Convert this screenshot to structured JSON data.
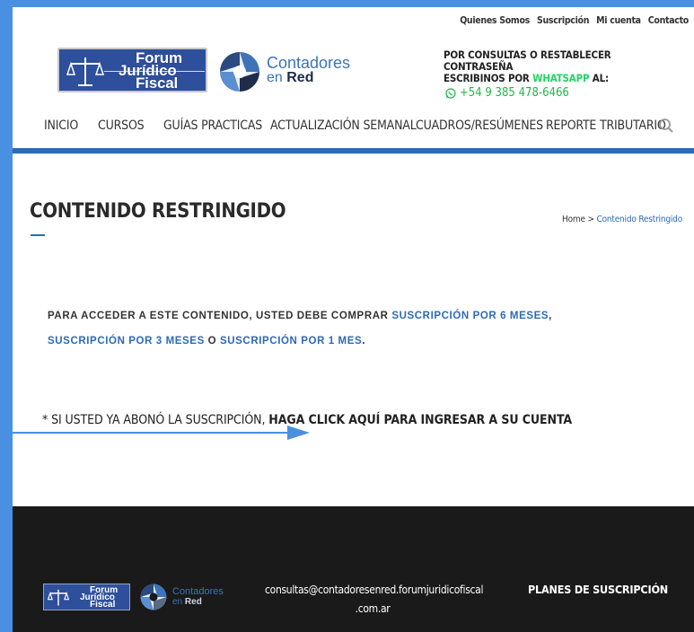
{
  "topbar": {
    "links": [
      "Quienes Somos",
      "Suscripción",
      "Mi cuenta",
      "Contacto"
    ]
  },
  "header": {
    "logo_forum": {
      "line1": "Forum",
      "line2": "Jurídico",
      "line3": "Fiscal"
    },
    "logo_cer": {
      "line1": "Contadores",
      "line2_prefix": "en ",
      "line2_bold": "Red"
    },
    "contact_line1": "POR CONSULTAS O RESTABLECER CONTRASEÑA",
    "contact_line2_prefix": "ESCRIBINOS POR ",
    "contact_line2_highlight": "WHATSAPP",
    "contact_line2_suffix": " AL:",
    "phone": "+54 9 385 478-6466"
  },
  "nav": {
    "items": [
      "INICIO",
      "CURSOS",
      "GUÍAS PRACTICAS",
      "ACTUALIZACIÓN SEMANAL",
      "CUADROS/RESÚMENES",
      "REPORTE TRIBUTARIO"
    ]
  },
  "page": {
    "title": "CONTENIDO RESTRINGIDO",
    "breadcrumb_home": "Home",
    "breadcrumb_sep": " > ",
    "breadcrumb_current": "Contenido Restringido"
  },
  "content": {
    "restrict_prefix": "PARA ACCEDER A ESTE CONTENIDO, USTED DEBE COMPRAR ",
    "link1": "SUSCRIPCIÓN POR 6 MESES",
    "sep1": ",",
    "link2": "SUSCRIPCIÓN POR 3 MESES",
    "sep2": " O ",
    "link3": "SUSCRIPCIÓN POR 1 MES",
    "sep3": ".",
    "notice_prefix": "* SI USTED YA ABONÓ LA SUSCRIPCIÓN, ",
    "notice_link": "HAGA CLICK AQUÍ PARA INGRESAR A SU CUENTA"
  },
  "footer": {
    "logo_forum": {
      "line1": "Forum",
      "line2": "Jurídico",
      "line3": "Fiscal"
    },
    "logo_cer": {
      "line1": "Contadores",
      "line2_prefix": "en ",
      "line2_bold": "Red"
    },
    "email_line1": "consultas@contadoresenred.forumjuridicofiscal",
    "email_line2": ".com.ar",
    "plans": "PLANES DE SUSCRIPCIÓN"
  },
  "colors": {
    "frame": "#4a90e2",
    "brand_blue": "#2e6ab3",
    "whatsapp_green": "#25d366",
    "footer_bg": "#1a1a1a"
  },
  "icons": [
    "scale-of-justice-icon",
    "aperture-logo-icon",
    "whatsapp-icon",
    "search-icon",
    "arrow-right-icon"
  ]
}
